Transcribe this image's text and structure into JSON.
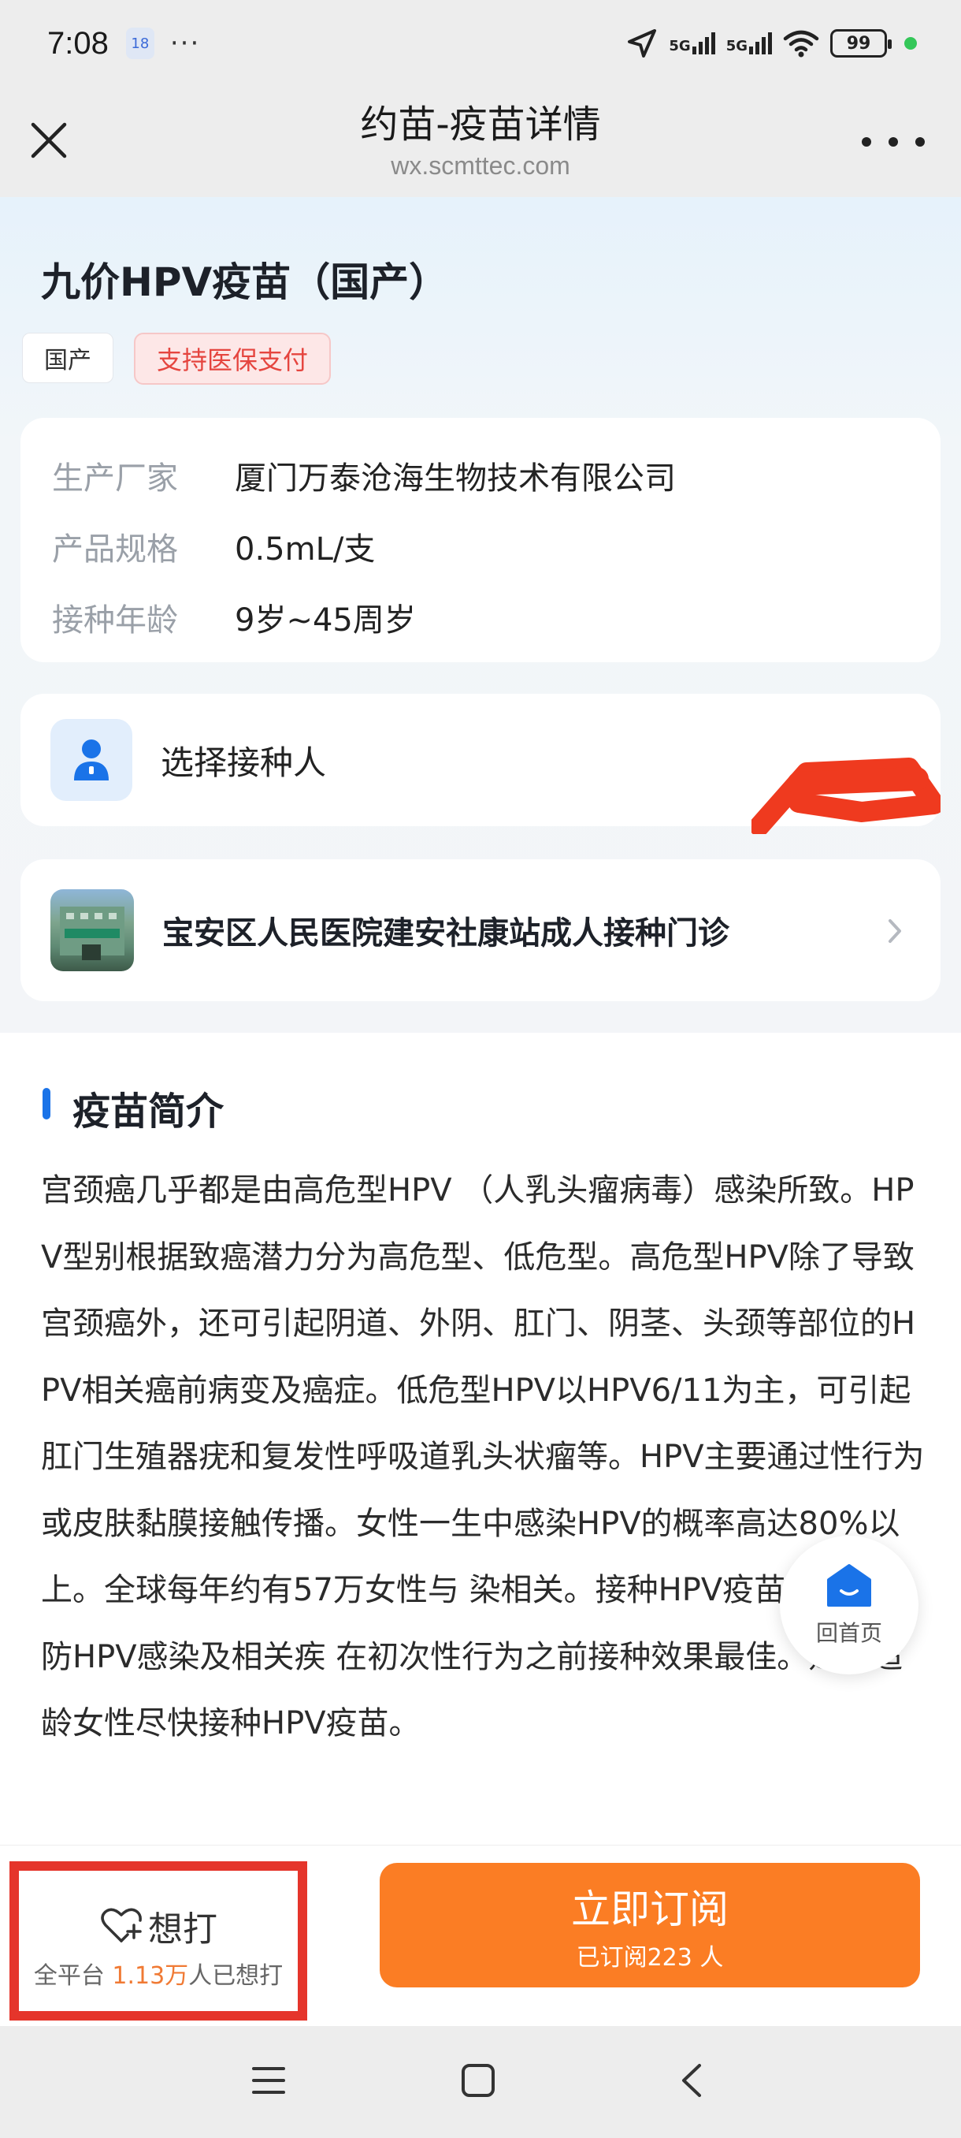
{
  "status_bar": {
    "time": "7:08",
    "badge": "18",
    "dots": "···",
    "network_1": "5G",
    "network_2": "5G",
    "battery": "99"
  },
  "title_bar": {
    "title": "约苗-疫苗详情",
    "subtitle": "wx.scmttec.com"
  },
  "vaccine": {
    "name": "九价HPV疫苗（国产）",
    "tags": [
      "国产",
      "支持医保支付"
    ],
    "info": [
      {
        "label": "生产厂家",
        "value": "厦门万泰沧海生物技术有限公司"
      },
      {
        "label": "产品规格",
        "value": "0.5mL/支"
      },
      {
        "label": "接种年龄",
        "value": "9岁~45周岁"
      }
    ]
  },
  "select_person": {
    "label": "选择接种人"
  },
  "clinic": {
    "name": "宝安区人民医院建安社康站成人接种门诊"
  },
  "intro": {
    "title": "疫苗简介",
    "text": "宫颈癌几乎都是由高危型HPV （人乳头瘤病毒）感染所致。HPV型别根据致癌潜力分为高危型、低危型。高危型HPV除了导致宫颈癌外，还可引起阴道、外阴、肛门、阴茎、头颈等部位的HPV相关癌前病变及癌症。低危型HPV以HPV6/11为主，可引起肛门生殖器疣和复发性呼吸道乳头状瘤等。HPV主要通过性行为或皮肤黏膜接触传播。女性一生中感染HPV的概率高达80%以上。全球每年约有57万女性与 染相关。接种HPV疫苗可有效预防HPV感染及相关疾 在初次性行为之前接种效果最佳。建议适龄女性尽快接种HPV疫苗。"
  },
  "home_float": {
    "label": "回首页"
  },
  "bottom": {
    "want_label": "想打",
    "want_prefix": "全平台 ",
    "want_count": "1.13万",
    "want_suffix": "人已想打",
    "subscribe_label": "立即订阅",
    "subscribe_sub": "已订阅223 人"
  },
  "colors": {
    "accent_orange": "#fb7d24",
    "accent_blue": "#1a73e8",
    "tag_red": "#e5453f",
    "highlight_box": "#e5352b"
  }
}
